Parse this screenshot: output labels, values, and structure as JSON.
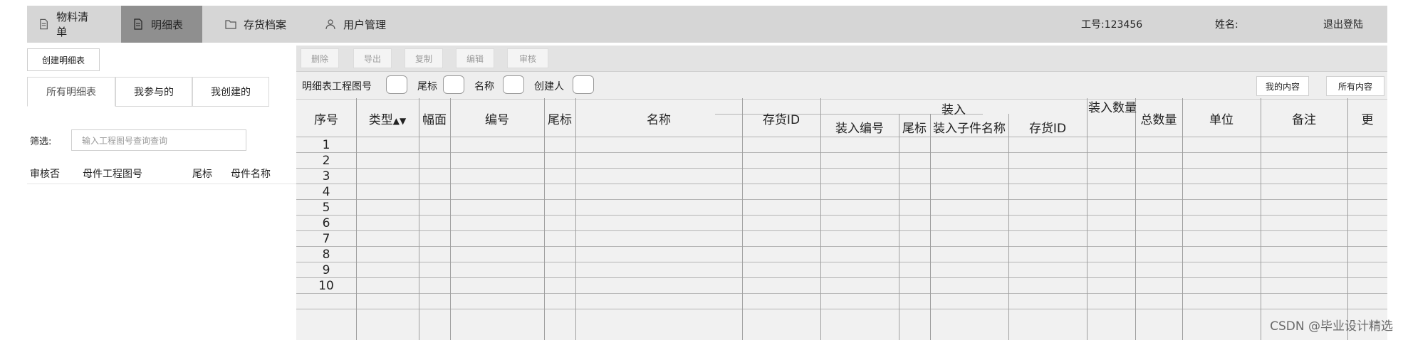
{
  "nav": {
    "tabs": [
      {
        "label": "物料清单",
        "icon": "document-icon",
        "active": false
      },
      {
        "label": "明细表",
        "icon": "document-icon",
        "active": true
      },
      {
        "label": "存货档案",
        "icon": "folder-icon",
        "active": false
      },
      {
        "label": "用户管理",
        "icon": "user-icon",
        "active": false
      }
    ],
    "employee_id": "工号:123456",
    "name_label": "姓名:",
    "logout": "退出登陆"
  },
  "left": {
    "create_button": "创建明细表",
    "tabs": [
      "所有明细表",
      "我参与的",
      "我创建的"
    ],
    "filter_label": "筛选:",
    "filter_placeholder": "输入工程图号查询查询",
    "columns": [
      "审核否",
      "母件工程图号",
      "尾标",
      "母件名称"
    ]
  },
  "toolbar": {
    "buttons": [
      "删除",
      "导出",
      "复制",
      "编辑",
      "审核"
    ]
  },
  "filterbar": {
    "fields": [
      "明细表工程图号",
      "尾标",
      "名称",
      "创建人"
    ],
    "right_buttons": [
      "我的内容",
      "所有内容"
    ]
  },
  "table": {
    "headers": {
      "seq": "序号",
      "type": "类型",
      "sort_icon": "sort-icon",
      "size": "幅面",
      "code": "编号",
      "tail": "尾标",
      "name": "名称",
      "inventory_id": "存货ID",
      "group_assembly": "装入",
      "assembly_code": "装入编号",
      "assembly_tail": "尾标",
      "assembly_child_name": "装入子件名称",
      "assembly_inventory_id": "存货ID",
      "assembly_qty": "装入数量",
      "total_qty": "总数量",
      "unit": "单位",
      "note": "备注",
      "more": "更"
    },
    "rows": [
      "1",
      "2",
      "3",
      "4",
      "5",
      "6",
      "7",
      "8",
      "9",
      "10"
    ]
  },
  "watermark": "CSDN @毕业设计精选"
}
